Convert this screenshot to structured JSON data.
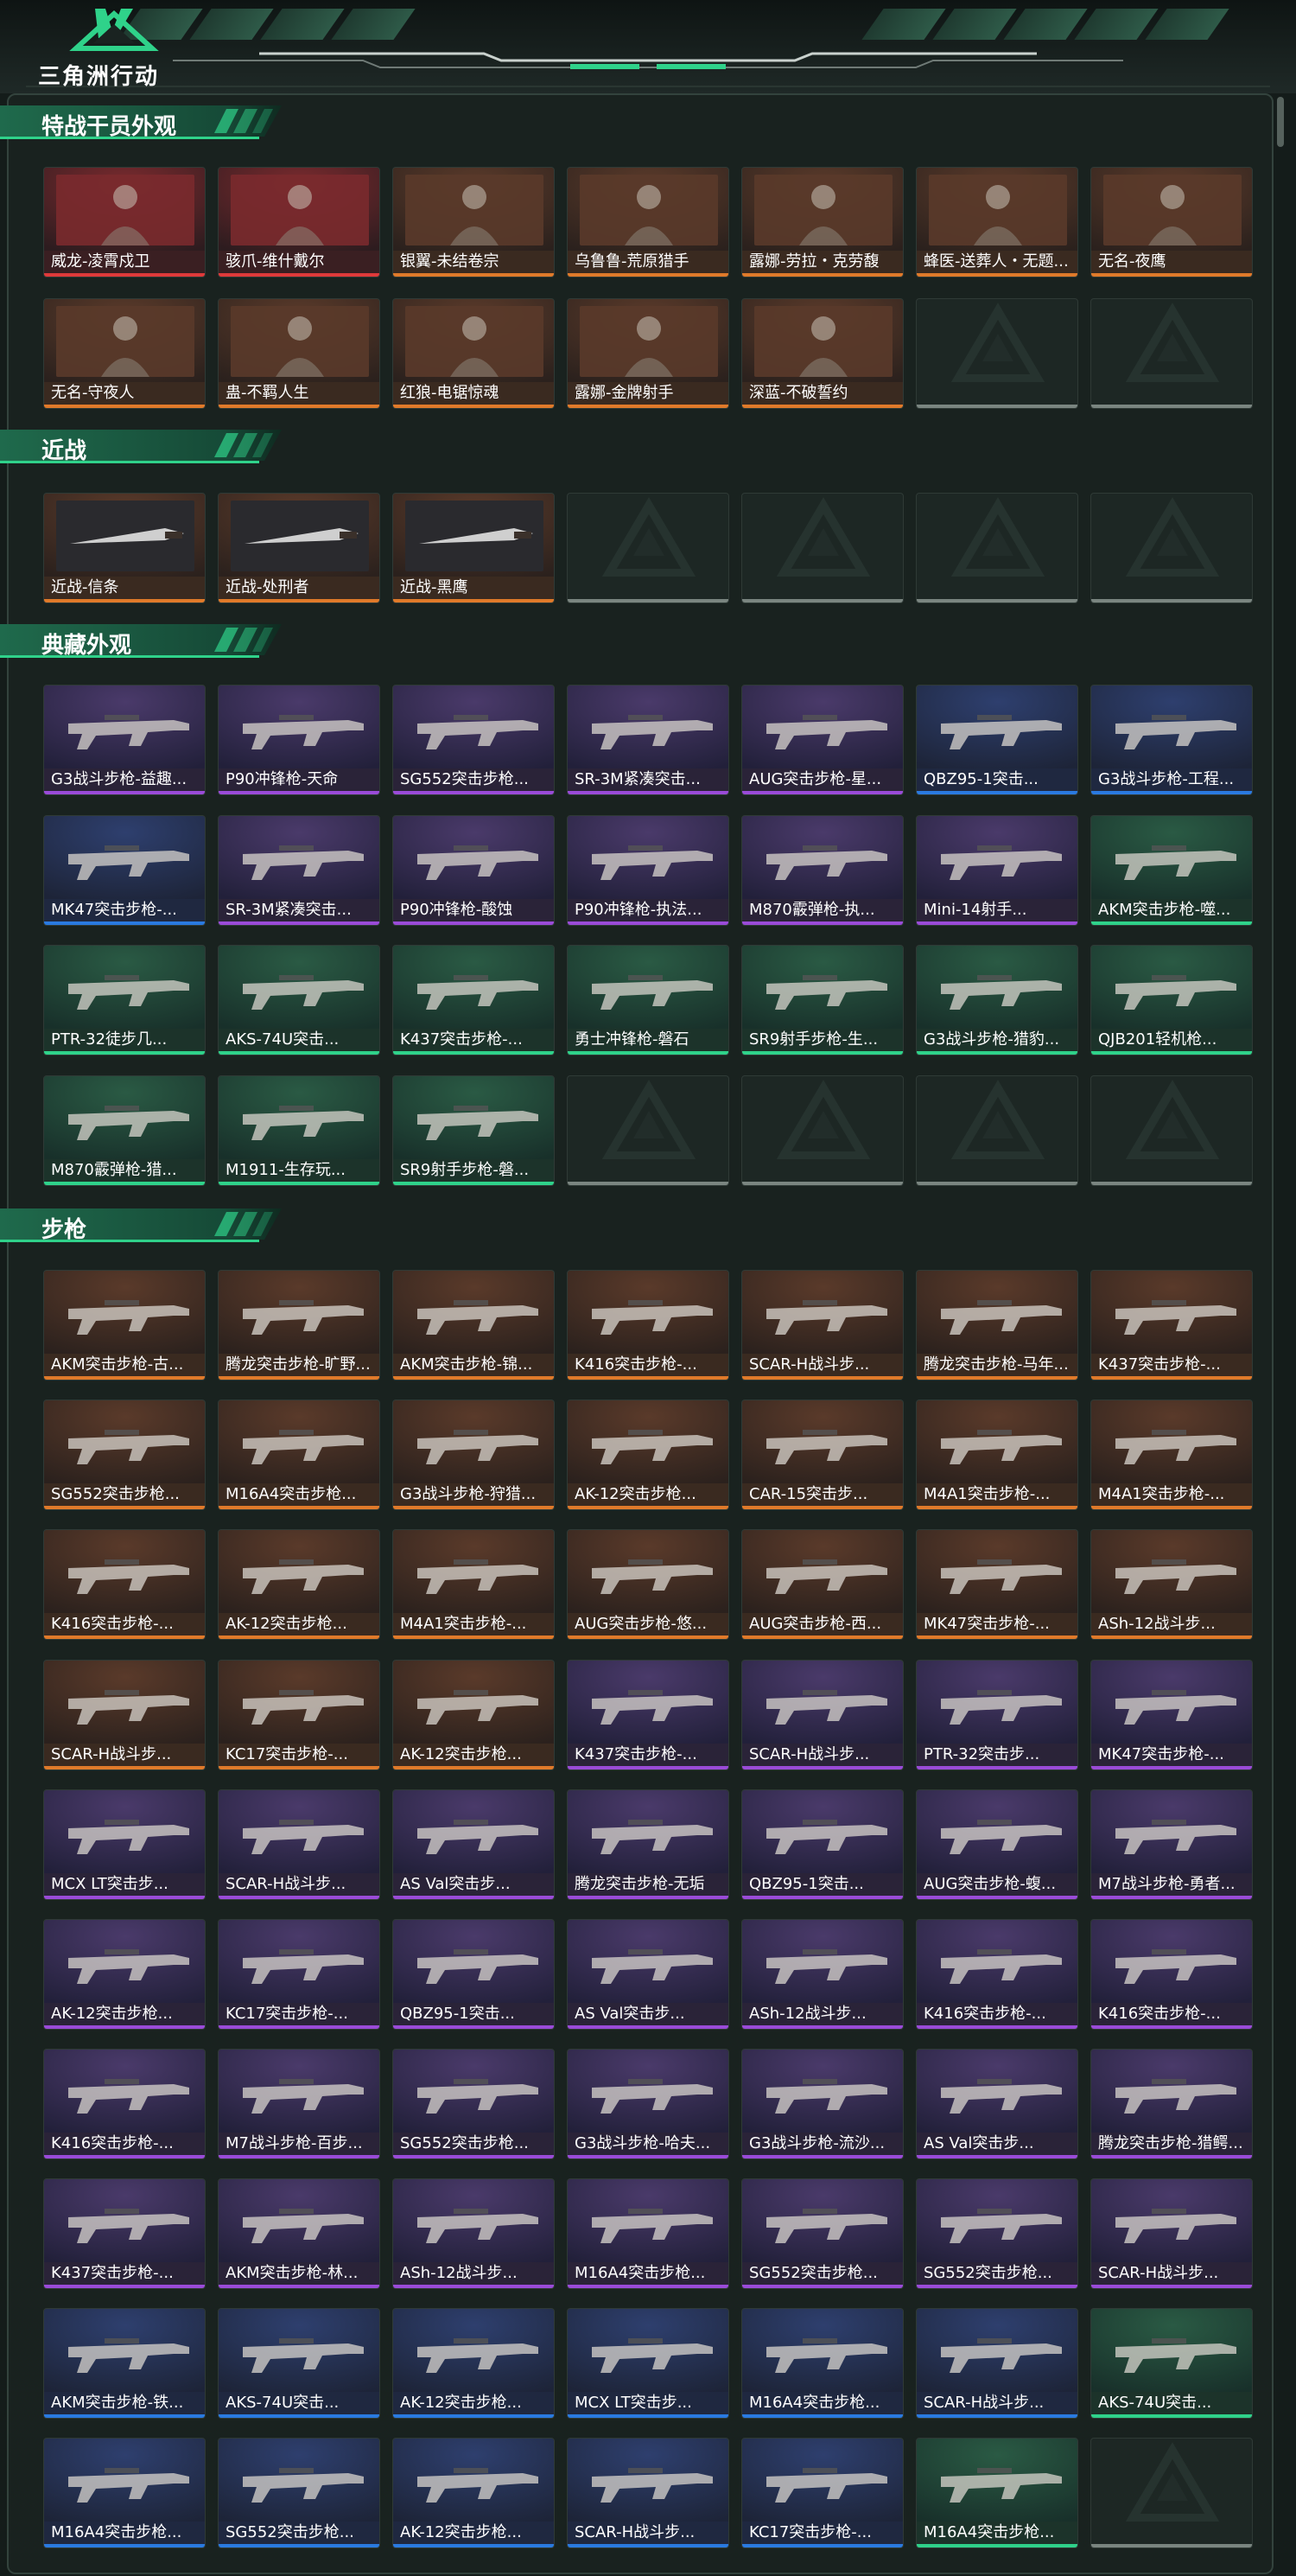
{
  "app": {
    "logo_text": "三角洲行动",
    "accent": "#2fd28a"
  },
  "sections": [
    {
      "title": "特战干员外观",
      "tiles": [
        {
          "label": "威龙-凌霄戍卫",
          "rarity": "red"
        },
        {
          "label": "骇爪-维什戴尔",
          "rarity": "red"
        },
        {
          "label": "银翼-未结卷宗",
          "rarity": "orange"
        },
        {
          "label": "乌鲁鲁-荒原猎手",
          "rarity": "orange"
        },
        {
          "label": "露娜-劳拉・克劳馥",
          "rarity": "orange"
        },
        {
          "label": "蜂医-送葬人・无题...",
          "rarity": "orange"
        },
        {
          "label": "无名-夜鹰",
          "rarity": "orange"
        },
        {
          "label": "无名-守夜人",
          "rarity": "orange"
        },
        {
          "label": "蛊-不羁人生",
          "rarity": "orange"
        },
        {
          "label": "红狼-电锯惊魂",
          "rarity": "orange"
        },
        {
          "label": "露娜-金牌射手",
          "rarity": "orange"
        },
        {
          "label": "深蓝-不破誓约",
          "rarity": "orange"
        },
        {
          "empty": true
        },
        {
          "empty": true
        }
      ]
    },
    {
      "title": "近战",
      "tiles": [
        {
          "label": "近战-信条",
          "rarity": "orange"
        },
        {
          "label": "近战-处刑者",
          "rarity": "orange"
        },
        {
          "label": "近战-黑鹰",
          "rarity": "orange"
        },
        {
          "empty": true
        },
        {
          "empty": true
        },
        {
          "empty": true
        },
        {
          "empty": true
        }
      ]
    },
    {
      "title": "典藏外观",
      "tiles": [
        {
          "label": "G3战斗步枪-益趣...",
          "rarity": "purple"
        },
        {
          "label": "P90冲锋枪-天命",
          "rarity": "purple"
        },
        {
          "label": "SG552突击步枪...",
          "rarity": "purple"
        },
        {
          "label": "SR-3M紧凑突击...",
          "rarity": "purple"
        },
        {
          "label": "AUG突击步枪-星...",
          "rarity": "purple"
        },
        {
          "label": "QBZ95-1突击...",
          "rarity": "blue"
        },
        {
          "label": "G3战斗步枪-工程...",
          "rarity": "blue"
        },
        {
          "label": "MK47突击步枪-...",
          "rarity": "blue"
        },
        {
          "label": "SR-3M紧凑突击...",
          "rarity": "purple"
        },
        {
          "label": "P90冲锋枪-酸蚀",
          "rarity": "purple"
        },
        {
          "label": "P90冲锋枪-执法...",
          "rarity": "purple"
        },
        {
          "label": "M870霰弹枪-执...",
          "rarity": "purple"
        },
        {
          "label": "Mini-14射手...",
          "rarity": "purple"
        },
        {
          "label": "AKM突击步枪-噬...",
          "rarity": "green"
        },
        {
          "label": "PTR-32徒步几...",
          "rarity": "green"
        },
        {
          "label": "AKS-74U突击...",
          "rarity": "green"
        },
        {
          "label": "K437突击步枪-...",
          "rarity": "green"
        },
        {
          "label": "勇士冲锋枪-磐石",
          "rarity": "green"
        },
        {
          "label": "SR9射手步枪-生...",
          "rarity": "green"
        },
        {
          "label": "G3战斗步枪-猎豹...",
          "rarity": "green"
        },
        {
          "label": "QJB201轻机枪...",
          "rarity": "green"
        },
        {
          "label": "M870霰弹枪-猎...",
          "rarity": "green"
        },
        {
          "label": "M1911-生存玩...",
          "rarity": "green"
        },
        {
          "label": "SR9射手步枪-磐...",
          "rarity": "green"
        },
        {
          "empty": true
        },
        {
          "empty": true
        },
        {
          "empty": true
        },
        {
          "empty": true
        }
      ]
    },
    {
      "title": "步枪",
      "tiles": [
        {
          "label": "AKM突击步枪-古...",
          "rarity": "orange"
        },
        {
          "label": "腾龙突击步枪-旷野...",
          "rarity": "orange"
        },
        {
          "label": "AKM突击步枪-锦...",
          "rarity": "orange"
        },
        {
          "label": "K416突击步枪-...",
          "rarity": "orange"
        },
        {
          "label": "SCAR-H战斗步...",
          "rarity": "orange"
        },
        {
          "label": "腾龙突击步枪-马年...",
          "rarity": "orange"
        },
        {
          "label": "K437突击步枪-...",
          "rarity": "orange"
        },
        {
          "label": "SG552突击步枪...",
          "rarity": "orange"
        },
        {
          "label": "M16A4突击步枪...",
          "rarity": "orange"
        },
        {
          "label": "G3战斗步枪-狩猎...",
          "rarity": "orange"
        },
        {
          "label": "AK-12突击步枪...",
          "rarity": "orange"
        },
        {
          "label": "CAR-15突击步...",
          "rarity": "orange"
        },
        {
          "label": "M4A1突击步枪-...",
          "rarity": "orange"
        },
        {
          "label": "M4A1突击步枪-...",
          "rarity": "orange"
        },
        {
          "label": "K416突击步枪-...",
          "rarity": "orange"
        },
        {
          "label": "AK-12突击步枪...",
          "rarity": "orange"
        },
        {
          "label": "M4A1突击步枪-...",
          "rarity": "orange"
        },
        {
          "label": "AUG突击步枪-悠...",
          "rarity": "orange"
        },
        {
          "label": "AUG突击步枪-西...",
          "rarity": "orange"
        },
        {
          "label": "MK47突击步枪-...",
          "rarity": "orange"
        },
        {
          "label": "ASh-12战斗步...",
          "rarity": "orange"
        },
        {
          "label": "SCAR-H战斗步...",
          "rarity": "orange"
        },
        {
          "label": "KC17突击步枪-...",
          "rarity": "orange"
        },
        {
          "label": "AK-12突击步枪...",
          "rarity": "orange"
        },
        {
          "label": "K437突击步枪-...",
          "rarity": "purple"
        },
        {
          "label": "SCAR-H战斗步...",
          "rarity": "purple"
        },
        {
          "label": "PTR-32突击步...",
          "rarity": "purple"
        },
        {
          "label": "MK47突击步枪-...",
          "rarity": "purple"
        },
        {
          "label": "MCX LT突击步...",
          "rarity": "purple"
        },
        {
          "label": "SCAR-H战斗步...",
          "rarity": "purple"
        },
        {
          "label": "AS Val突击步...",
          "rarity": "purple"
        },
        {
          "label": "腾龙突击步枪-无垢",
          "rarity": "purple"
        },
        {
          "label": "QBZ95-1突击...",
          "rarity": "purple"
        },
        {
          "label": "AUG突击步枪-蝮...",
          "rarity": "purple"
        },
        {
          "label": "M7战斗步枪-勇者...",
          "rarity": "purple"
        },
        {
          "label": "AK-12突击步枪...",
          "rarity": "purple"
        },
        {
          "label": "KC17突击步枪-...",
          "rarity": "purple"
        },
        {
          "label": "QBZ95-1突击...",
          "rarity": "purple"
        },
        {
          "label": "AS Val突击步...",
          "rarity": "purple"
        },
        {
          "label": "ASh-12战斗步...",
          "rarity": "purple"
        },
        {
          "label": "K416突击步枪-...",
          "rarity": "purple"
        },
        {
          "label": "K416突击步枪-...",
          "rarity": "purple"
        },
        {
          "label": "K416突击步枪-...",
          "rarity": "purple"
        },
        {
          "label": "M7战斗步枪-百步...",
          "rarity": "purple"
        },
        {
          "label": "SG552突击步枪...",
          "rarity": "purple"
        },
        {
          "label": "G3战斗步枪-哈夫...",
          "rarity": "purple"
        },
        {
          "label": "G3战斗步枪-流沙...",
          "rarity": "purple"
        },
        {
          "label": "AS Val突击步...",
          "rarity": "purple"
        },
        {
          "label": "腾龙突击步枪-猎鳄...",
          "rarity": "purple"
        },
        {
          "label": "K437突击步枪-...",
          "rarity": "purple"
        },
        {
          "label": "AKM突击步枪-林...",
          "rarity": "purple"
        },
        {
          "label": "ASh-12战斗步...",
          "rarity": "purple"
        },
        {
          "label": "M16A4突击步枪...",
          "rarity": "purple"
        },
        {
          "label": "SG552突击步枪...",
          "rarity": "purple"
        },
        {
          "label": "SG552突击步枪...",
          "rarity": "purple"
        },
        {
          "label": "SCAR-H战斗步...",
          "rarity": "purple"
        },
        {
          "label": "AKM突击步枪-铁...",
          "rarity": "blue"
        },
        {
          "label": "AKS-74U突击...",
          "rarity": "blue"
        },
        {
          "label": "AK-12突击步枪...",
          "rarity": "blue"
        },
        {
          "label": "MCX LT突击步...",
          "rarity": "blue"
        },
        {
          "label": "M16A4突击步枪...",
          "rarity": "blue"
        },
        {
          "label": "SCAR-H战斗步...",
          "rarity": "blue"
        },
        {
          "label": "AKS-74U突击...",
          "rarity": "green"
        },
        {
          "label": "M16A4突击步枪...",
          "rarity": "blue"
        },
        {
          "label": "SG552突击步枪...",
          "rarity": "blue"
        },
        {
          "label": "AK-12突击步枪...",
          "rarity": "blue"
        },
        {
          "label": "SCAR-H战斗步...",
          "rarity": "blue"
        },
        {
          "label": "KC17突击步枪-...",
          "rarity": "blue"
        },
        {
          "label": "M16A4突击步枪...",
          "rarity": "green"
        },
        {
          "empty": true
        }
      ]
    }
  ]
}
